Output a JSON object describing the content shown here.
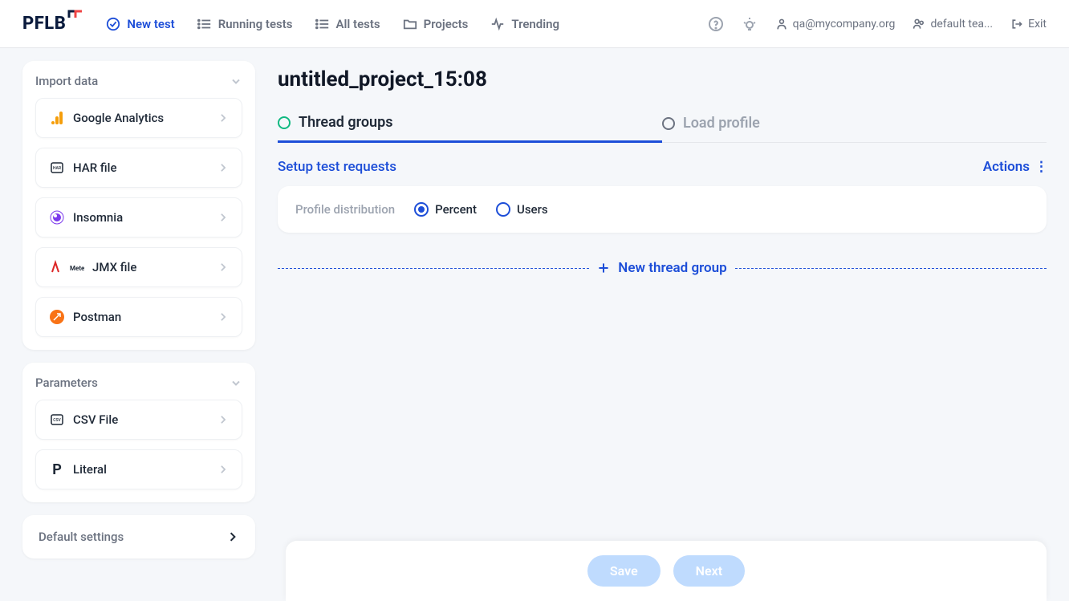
{
  "logo": "PFLB",
  "nav": {
    "new_test": "New test",
    "running": "Running tests",
    "all": "All tests",
    "projects": "Projects",
    "trending": "Trending"
  },
  "header": {
    "user": "qa@mycompany.org",
    "team": "default tea...",
    "exit": "Exit"
  },
  "sidebar": {
    "import": {
      "title": "Import data",
      "items": [
        "Google Analytics",
        "HAR file",
        "Insomnia",
        "JMX file",
        "Postman"
      ]
    },
    "params": {
      "title": "Parameters",
      "items": [
        "CSV File",
        "Literal"
      ]
    },
    "default": "Default settings"
  },
  "main": {
    "title": "untitled_project_15:08",
    "tabs": {
      "thread": "Thread groups",
      "load": "Load profile"
    },
    "setup": "Setup test requests",
    "actions": "Actions",
    "dist": {
      "label": "Profile distribution",
      "percent": "Percent",
      "users": "Users"
    },
    "new_group": "New thread group"
  },
  "footer": {
    "save": "Save",
    "next": "Next"
  }
}
